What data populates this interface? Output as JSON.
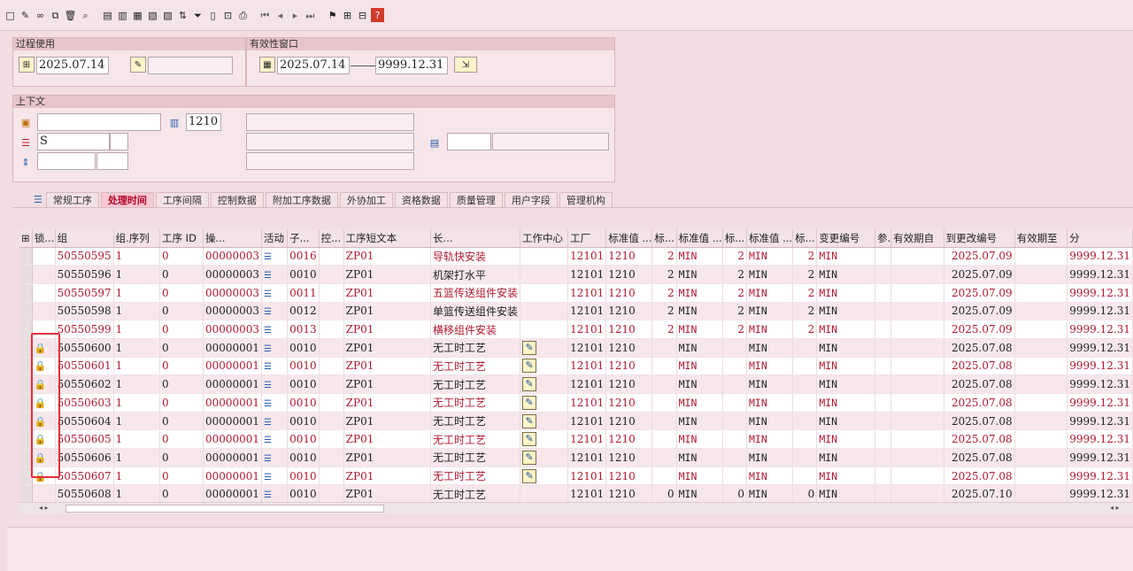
{
  "toolbar": {
    "icons": [
      "new-document",
      "edit-pencil",
      "change-glasses",
      "copy",
      "delete",
      "find",
      "pick1",
      "pick2",
      "pick3",
      "pick4",
      "pick5",
      "sort",
      "filter",
      "columns",
      "filter2",
      "print",
      "first",
      "prev",
      "next",
      "last",
      "mass-change",
      "sel",
      "display",
      "help"
    ]
  },
  "process": {
    "header": "过程使用",
    "date": "2025.07.14"
  },
  "validity": {
    "header": "有效性窗口",
    "from": "2025.07.14",
    "to": "9999.12.31"
  },
  "context": {
    "header": "上下文",
    "plant": "1210",
    "s_value": "S"
  },
  "tabs": [
    {
      "label": "常规工序"
    },
    {
      "label": "处理时间"
    },
    {
      "label": "工序间隔"
    },
    {
      "label": "控制数据"
    },
    {
      "label": "附加工序数据"
    },
    {
      "label": "外协加工"
    },
    {
      "label": "资格数据"
    },
    {
      "label": "质量管理"
    },
    {
      "label": "用户字段"
    },
    {
      "label": "管理机构"
    }
  ],
  "table": {
    "headers": [
      "锁...",
      "组",
      "组.序列",
      "工序 ID",
      "操...",
      "活动",
      "子...",
      "控...",
      "工序短文本",
      "长...",
      "工作中心",
      "工厂",
      "标准值 ...",
      "标...",
      "标准值 ...",
      "标...",
      "标准值 ...",
      "标...",
      "变更编号",
      "参.",
      "有效期自",
      "到更改编号",
      "有效期至",
      "分"
    ],
    "rows": [
      {
        "group": "50550595",
        "seq": "1",
        "seq2": "0",
        "opid": "00000003",
        "act": "0016",
        "ctrl": "ZP01",
        "text": "导轨快安装",
        "wc": "12101",
        "plant": "1210",
        "v1": "2",
        "u1": "MIN",
        "v2": "2",
        "u2": "MIN",
        "v3": "2",
        "u3": "MIN",
        "from": "2025.07.09",
        "to": "9999.12.31",
        "lock": false,
        "edit": false,
        "red": true
      },
      {
        "group": "50550596",
        "seq": "1",
        "seq2": "0",
        "opid": "00000003",
        "act": "0010",
        "ctrl": "ZP01",
        "text": "机架打水平",
        "wc": "12101",
        "plant": "1210",
        "v1": "2",
        "u1": "MIN",
        "v2": "2",
        "u2": "MIN",
        "v3": "2",
        "u3": "MIN",
        "from": "2025.07.09",
        "to": "9999.12.31",
        "lock": false,
        "edit": false,
        "red": false
      },
      {
        "group": "50550597",
        "seq": "1",
        "seq2": "0",
        "opid": "00000003",
        "act": "0011",
        "ctrl": "ZP01",
        "text": "五篮传送组件安装",
        "wc": "12101",
        "plant": "1210",
        "v1": "2",
        "u1": "MIN",
        "v2": "2",
        "u2": "MIN",
        "v3": "2",
        "u3": "MIN",
        "from": "2025.07.09",
        "to": "9999.12.31",
        "lock": false,
        "edit": false,
        "red": true
      },
      {
        "group": "50550598",
        "seq": "1",
        "seq2": "0",
        "opid": "00000003",
        "act": "0012",
        "ctrl": "ZP01",
        "text": "单篮传送组件安装",
        "wc": "12101",
        "plant": "1210",
        "v1": "2",
        "u1": "MIN",
        "v2": "2",
        "u2": "MIN",
        "v3": "2",
        "u3": "MIN",
        "from": "2025.07.09",
        "to": "9999.12.31",
        "lock": false,
        "edit": false,
        "red": false
      },
      {
        "group": "50550599",
        "seq": "1",
        "seq2": "0",
        "opid": "00000003",
        "act": "0013",
        "ctrl": "ZP01",
        "text": "横移组件安装",
        "wc": "12101",
        "plant": "1210",
        "v1": "2",
        "u1": "MIN",
        "v2": "2",
        "u2": "MIN",
        "v3": "2",
        "u3": "MIN",
        "from": "2025.07.09",
        "to": "9999.12.31",
        "lock": false,
        "edit": false,
        "red": true
      },
      {
        "group": "50550600",
        "seq": "1",
        "seq2": "0",
        "opid": "00000001",
        "act": "0010",
        "ctrl": "ZP01",
        "text": "无工时工艺",
        "wc": "12101",
        "plant": "1210",
        "v1": "",
        "u1": "MIN",
        "v2": "",
        "u2": "MIN",
        "v3": "",
        "u3": "MIN",
        "from": "2025.07.08",
        "to": "9999.12.31",
        "lock": true,
        "edit": true,
        "red": false
      },
      {
        "group": "50550601",
        "seq": "1",
        "seq2": "0",
        "opid": "00000001",
        "act": "0010",
        "ctrl": "ZP01",
        "text": "无工时工艺",
        "wc": "12101",
        "plant": "1210",
        "v1": "",
        "u1": "MIN",
        "v2": "",
        "u2": "MIN",
        "v3": "",
        "u3": "MIN",
        "from": "2025.07.08",
        "to": "9999.12.31",
        "lock": true,
        "edit": true,
        "red": true
      },
      {
        "group": "50550602",
        "seq": "1",
        "seq2": "0",
        "opid": "00000001",
        "act": "0010",
        "ctrl": "ZP01",
        "text": "无工时工艺",
        "wc": "12101",
        "plant": "1210",
        "v1": "",
        "u1": "MIN",
        "v2": "",
        "u2": "MIN",
        "v3": "",
        "u3": "MIN",
        "from": "2025.07.08",
        "to": "9999.12.31",
        "lock": true,
        "edit": true,
        "red": false
      },
      {
        "group": "50550603",
        "seq": "1",
        "seq2": "0",
        "opid": "00000001",
        "act": "0010",
        "ctrl": "ZP01",
        "text": "无工时工艺",
        "wc": "12101",
        "plant": "1210",
        "v1": "",
        "u1": "MIN",
        "v2": "",
        "u2": "MIN",
        "v3": "",
        "u3": "MIN",
        "from": "2025.07.08",
        "to": "9999.12.31",
        "lock": true,
        "edit": true,
        "red": true
      },
      {
        "group": "50550604",
        "seq": "1",
        "seq2": "0",
        "opid": "00000001",
        "act": "0010",
        "ctrl": "ZP01",
        "text": "无工时工艺",
        "wc": "12101",
        "plant": "1210",
        "v1": "",
        "u1": "MIN",
        "v2": "",
        "u2": "MIN",
        "v3": "",
        "u3": "MIN",
        "from": "2025.07.08",
        "to": "9999.12.31",
        "lock": true,
        "edit": true,
        "red": false
      },
      {
        "group": "50550605",
        "seq": "1",
        "seq2": "0",
        "opid": "00000001",
        "act": "0010",
        "ctrl": "ZP01",
        "text": "无工时工艺",
        "wc": "12101",
        "plant": "1210",
        "v1": "",
        "u1": "MIN",
        "v2": "",
        "u2": "MIN",
        "v3": "",
        "u3": "MIN",
        "from": "2025.07.08",
        "to": "9999.12.31",
        "lock": true,
        "edit": true,
        "red": true
      },
      {
        "group": "50550606",
        "seq": "1",
        "seq2": "0",
        "opid": "00000001",
        "act": "0010",
        "ctrl": "ZP01",
        "text": "无工时工艺",
        "wc": "12101",
        "plant": "1210",
        "v1": "",
        "u1": "MIN",
        "v2": "",
        "u2": "MIN",
        "v3": "",
        "u3": "MIN",
        "from": "2025.07.08",
        "to": "9999.12.31",
        "lock": true,
        "edit": true,
        "red": false
      },
      {
        "group": "50550607",
        "seq": "1",
        "seq2": "0",
        "opid": "00000001",
        "act": "0010",
        "ctrl": "ZP01",
        "text": "无工时工艺",
        "wc": "12101",
        "plant": "1210",
        "v1": "",
        "u1": "MIN",
        "v2": "",
        "u2": "MIN",
        "v3": "",
        "u3": "MIN",
        "from": "2025.07.08",
        "to": "9999.12.31",
        "lock": true,
        "edit": true,
        "red": true
      },
      {
        "group": "50550608",
        "seq": "1",
        "seq2": "0",
        "opid": "00000001",
        "act": "0010",
        "ctrl": "ZP01",
        "text": "无工时工艺",
        "wc": "12101",
        "plant": "1210",
        "v1": "0",
        "u1": "MIN",
        "v2": "0",
        "u2": "MIN",
        "v3": "0",
        "u3": "MIN",
        "from": "2025.07.10",
        "to": "9999.12.31",
        "lock": false,
        "edit": false,
        "red": false
      }
    ]
  },
  "colors": {
    "accent_red": "#b0182f",
    "lock_blue": "#2a5db0",
    "highlight_box": "#e0303a"
  }
}
